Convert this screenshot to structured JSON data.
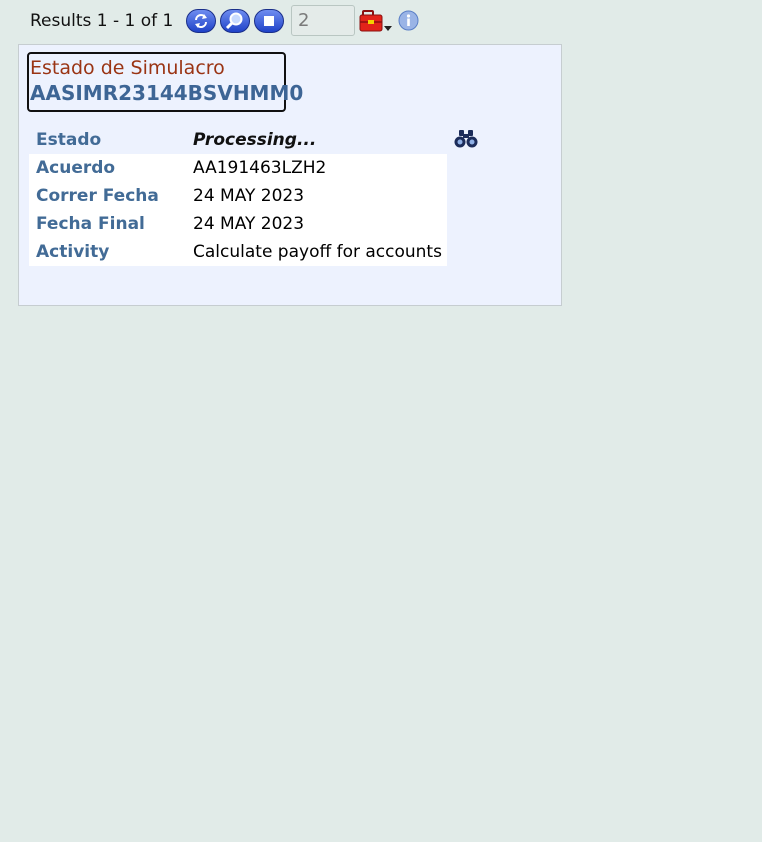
{
  "toolbar": {
    "results_text": "Results 1 - 1 of 1",
    "page_value": "2",
    "icons": [
      "refresh-icon",
      "search-icon",
      "stop-icon",
      "toolbox-icon",
      "info-icon"
    ]
  },
  "panel": {
    "title_label": "Estado de Simulacro",
    "title_id": "AASIMR23144BSVHMM0",
    "rows": [
      {
        "label": "Estado",
        "value": "Processing..."
      },
      {
        "label": "Acuerdo",
        "value": "AA191463LZH2"
      },
      {
        "label": "Correr Fecha",
        "value": "24 MAY 2023"
      },
      {
        "label": "Fecha Final",
        "value": "24 MAY 2023"
      },
      {
        "label": "Activity",
        "value": "Calculate payoff for accounts"
      }
    ]
  },
  "colors": {
    "background": "#e1ebe8",
    "panel_background": "#edf2fe",
    "title_label": "#9a3414",
    "title_id": "#3d6595",
    "field_label": "#426b96",
    "button_blue": "#1f42c8"
  }
}
